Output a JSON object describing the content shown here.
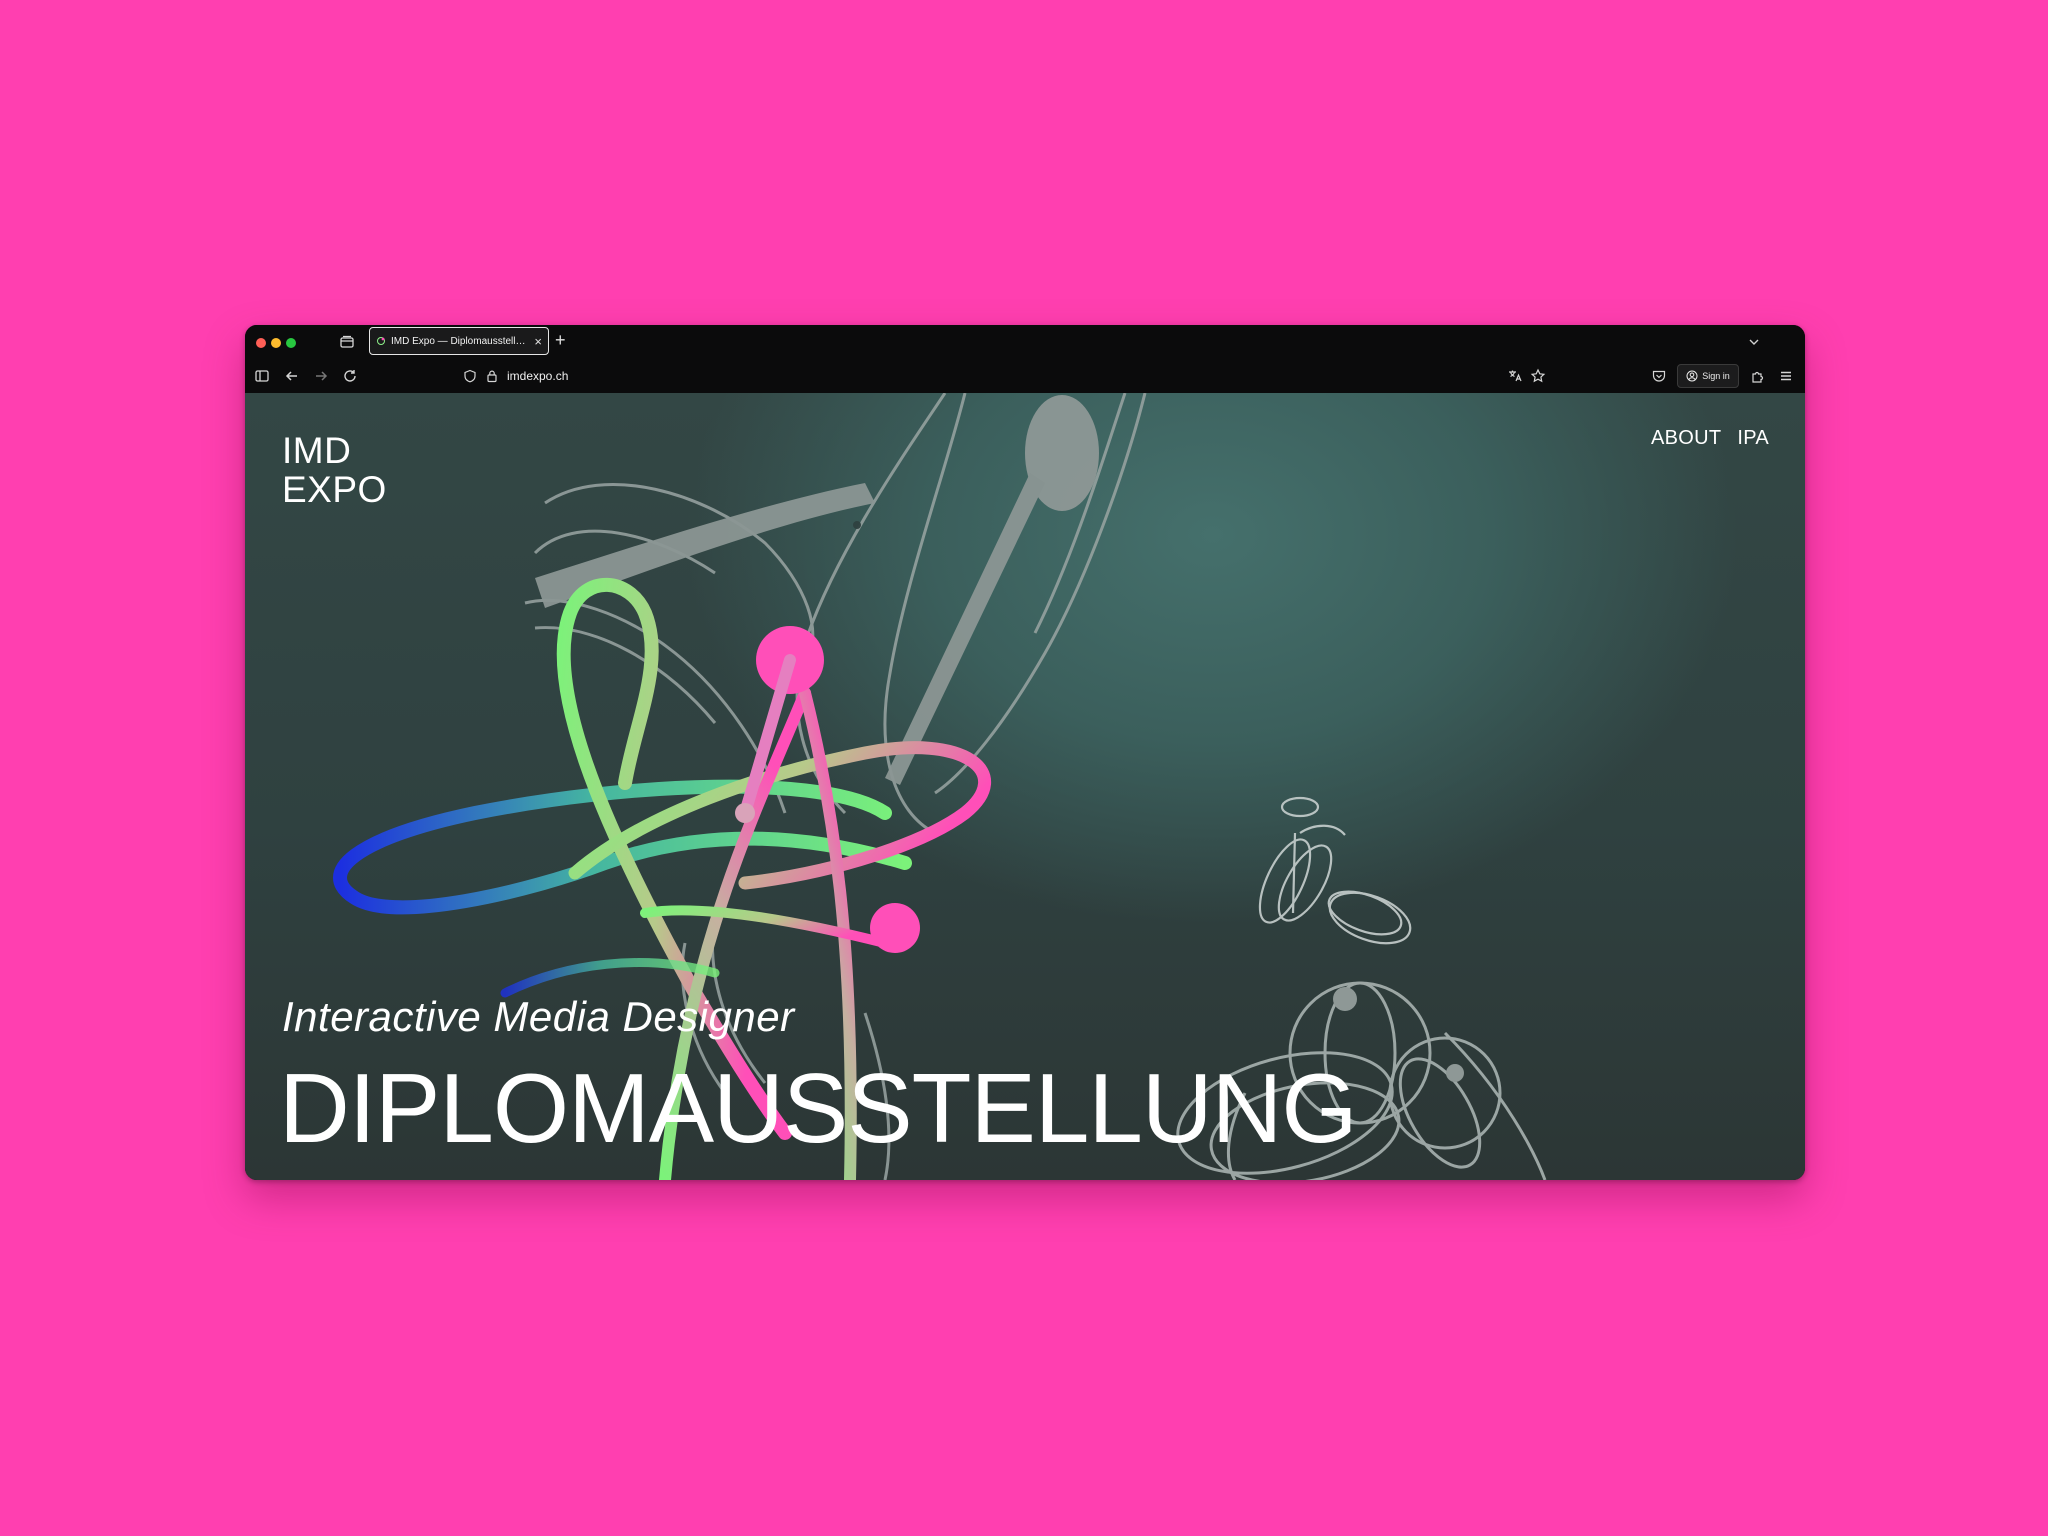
{
  "browser": {
    "tab_title": "IMD Expo — Diplomausstellung",
    "url": "imdexpo.ch",
    "sign_in_label": "Sign in"
  },
  "site": {
    "logo_line1": "IMD",
    "logo_line2": "EXPO",
    "nav": [
      {
        "label": "ABOUT"
      },
      {
        "label": "IPA"
      }
    ],
    "subtitle": "Interactive Media Designer",
    "headline": "DIPLOMAUSSTELLUNG"
  },
  "colors": {
    "backdrop": "#ff3fb0",
    "accent_pink": "#ff4fb8",
    "accent_green": "#7cf27a",
    "accent_blue": "#1c2fe0"
  }
}
